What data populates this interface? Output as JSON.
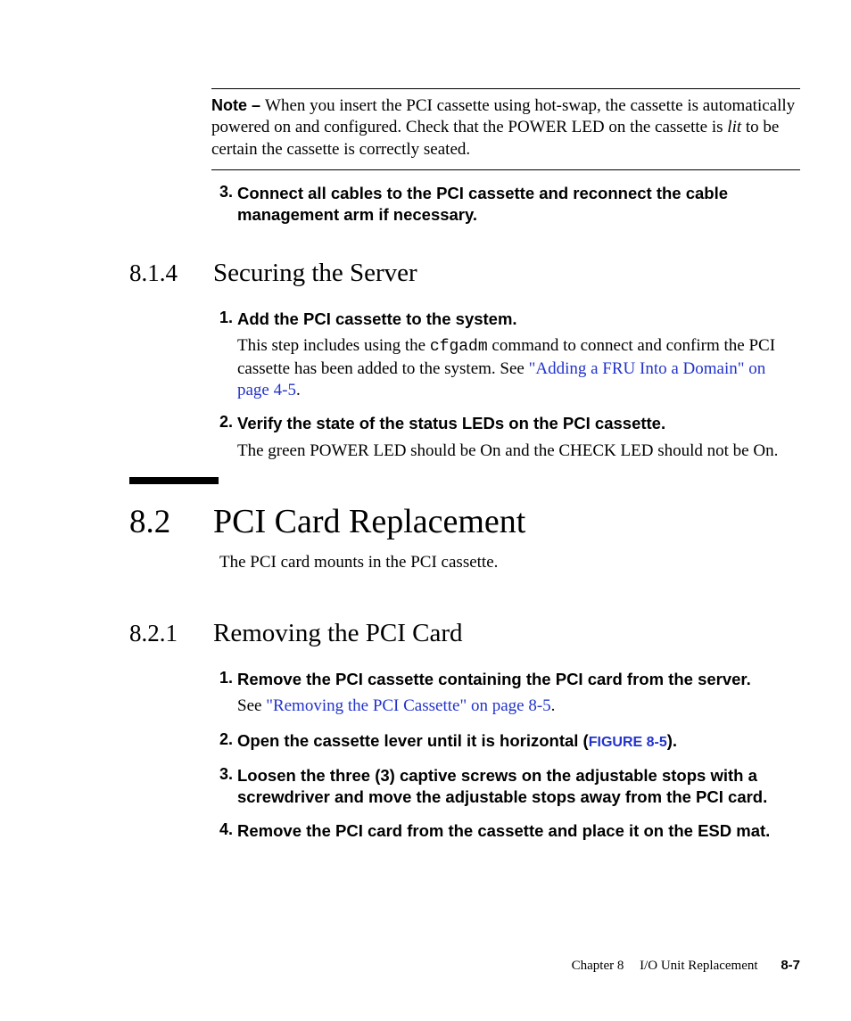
{
  "note": {
    "label": "Note – ",
    "body_a": "When you insert the PCI cassette using hot-swap, the cassette is automatically powered on and configured. Check that the POWER LED on the cassette is ",
    "lit": "lit",
    "body_b": " to be certain the cassette is correctly seated."
  },
  "topstep": {
    "num": "3.",
    "bold": "Connect all cables to the PCI cassette and reconnect the cable management arm if necessary."
  },
  "sec814": {
    "num": "8.1.4",
    "title": "Securing the Server",
    "step1": {
      "num": "1.",
      "bold": "Add the PCI cassette to the system.",
      "desc_a": "This step includes using the ",
      "cmd": "cfgadm",
      "desc_b": " command to connect and confirm the PCI cassette has been added to the system. See ",
      "xref": "\"Adding a FRU Into a Domain\" on page 4-5",
      "period": "."
    },
    "step2": {
      "num": "2.",
      "bold": "Verify the state of the status LEDs on the PCI cassette.",
      "desc": "The green POWER LED should be On and the CHECK LED should not be On."
    }
  },
  "sec82": {
    "num": "8.2",
    "title": "PCI Card Replacement",
    "intro": "The PCI card mounts in the PCI cassette."
  },
  "sec821": {
    "num": "8.2.1",
    "title": "Removing the PCI Card",
    "step1": {
      "num": "1.",
      "bold": "Remove the PCI cassette containing the PCI card from the server.",
      "desc_a": "See ",
      "xref": "\"Removing the PCI Cassette\" on page 8-5",
      "period": "."
    },
    "step2": {
      "num": "2.",
      "bold_a": "Open the cassette lever until it is horizontal (",
      "figref": "FIGURE 8-5",
      "bold_b": ")."
    },
    "step3": {
      "num": "3.",
      "bold": "Loosen the three (3) captive screws on the adjustable stops with a screwdriver and move the adjustable stops away from the PCI card."
    },
    "step4": {
      "num": "4.",
      "bold": "Remove the PCI card from the cassette and place it on the ESD mat."
    }
  },
  "footer": {
    "chapter": "Chapter 8",
    "title": "I/O Unit Replacement",
    "page": "8-7"
  }
}
